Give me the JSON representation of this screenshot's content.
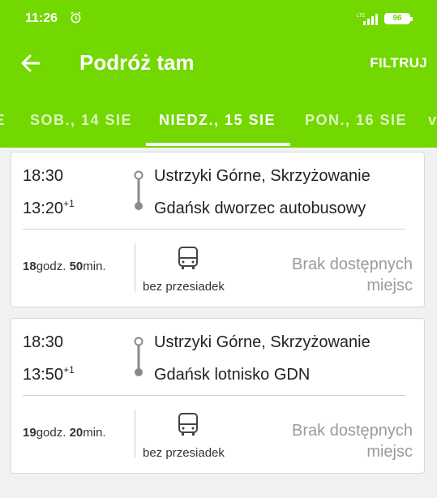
{
  "status_bar": {
    "time": "11:26",
    "network": "LTE",
    "battery": "96"
  },
  "header": {
    "title": "Podróż tam",
    "filter_label": "FILTRUJ"
  },
  "tabs": [
    {
      "label": "SOB., 14 SIE"
    },
    {
      "label": "NIEDZ., 15 SIE"
    },
    {
      "label": "PON., 16 SIE"
    }
  ],
  "trips": [
    {
      "departure_time": "18:30",
      "arrival_time": "13:20",
      "arrival_day_offset": "+1",
      "from": "Ustrzyki Górne, Skrzyżowanie",
      "to": "Gdańsk dworzec autobusowy",
      "duration_hours": "18",
      "duration_hours_unit": "godz.",
      "duration_minutes": "50",
      "duration_minutes_unit": "min.",
      "transfers": "bez przesiadek",
      "availability_line1": "Brak dostępnych",
      "availability_line2": "miejsc"
    },
    {
      "departure_time": "18:30",
      "arrival_time": "13:50",
      "arrival_day_offset": "+1",
      "from": "Ustrzyki Górne, Skrzyżowanie",
      "to": "Gdańsk lotnisko GDN",
      "duration_hours": "19",
      "duration_hours_unit": "godz.",
      "duration_minutes": "20",
      "duration_minutes_unit": "min.",
      "transfers": "bez przesiadek",
      "availability_line1": "Brak dostępnych",
      "availability_line2": "miejsc"
    }
  ],
  "colors": {
    "brand_green": "#73d700",
    "unavailable_text": "#9a9a9a"
  }
}
